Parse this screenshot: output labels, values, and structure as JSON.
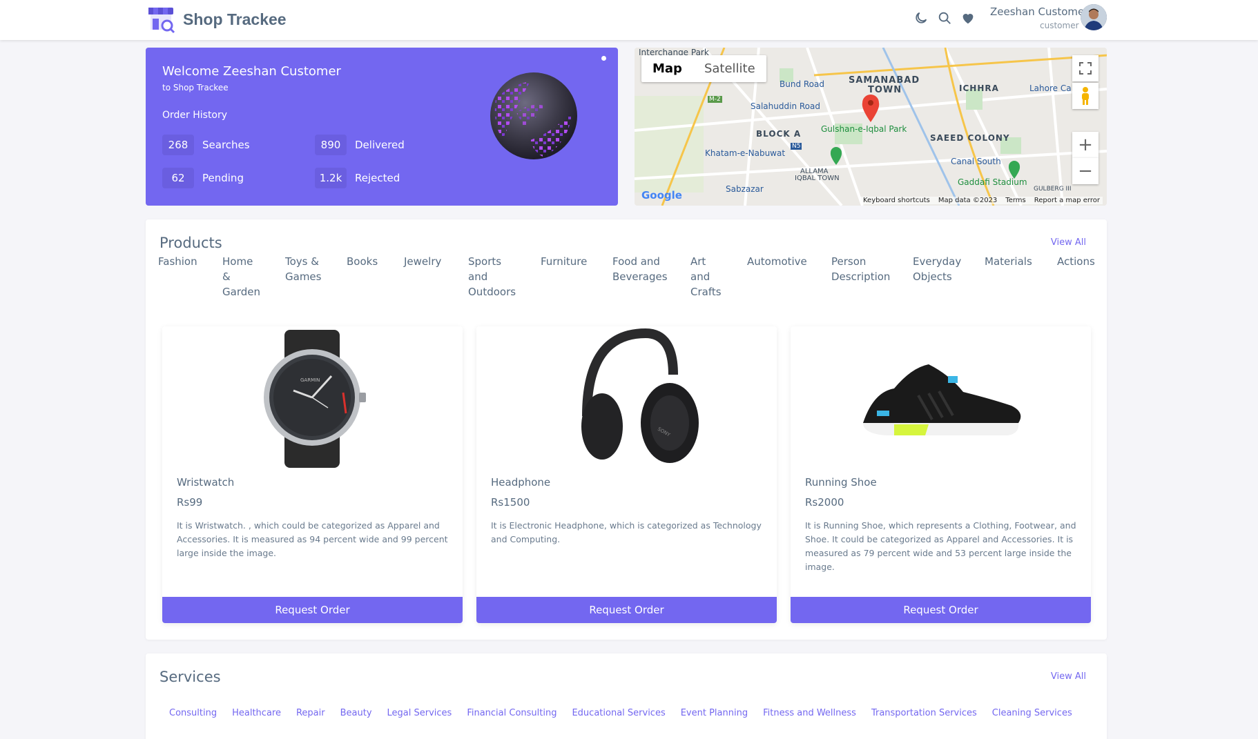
{
  "header": {
    "brand": "Shop Trackee",
    "icons": [
      "moon-icon",
      "search-icon",
      "heart-icon"
    ],
    "user_name": "Zeeshan Customer",
    "user_role": "customer"
  },
  "welcome": {
    "title": "Welcome Zeeshan Customer",
    "subtitle": "to Shop Trackee",
    "order_history": "Order History",
    "stats": [
      {
        "value": "268",
        "label": "Searches"
      },
      {
        "value": "890",
        "label": "Delivered"
      },
      {
        "value": "62",
        "label": "Pending"
      },
      {
        "value": "1.2k",
        "label": "Rejected"
      }
    ]
  },
  "map": {
    "tab_map": "Map",
    "tab_satellite": "Satellite",
    "labels": {
      "interchange": "Interchange Park",
      "samanabad": "SAMANABAD",
      "town": "TOWN",
      "ichhra": "ICHHRA",
      "bund_road": "Bund Road",
      "salahuddin": "Salahuddin Road",
      "block_a": "BLOCK A",
      "gulshan": "Gulshan-e-Iqbal Park",
      "saeed_colony": "SAEED COLONY",
      "khatam": "Khatam-e-Nabuwat",
      "allama": "ALLAMA",
      "iqbal_town": "IQBAL TOWN",
      "canal_south": "Canal South",
      "gaddafi": "Gaddafi Stadium",
      "sabzazar": "Sabzazar",
      "lahore_canal": "Lahore Ca",
      "gulberg": "GULBERG III",
      "m2": "M-2",
      "n5": "N5",
      "google": "Google"
    },
    "footer": [
      "Keyboard shortcuts",
      "Map data ©2023",
      "Terms",
      "Report a map error"
    ]
  },
  "products": {
    "title": "Products",
    "view_all": "View All",
    "categories": [
      "Fashion",
      "Home & Garden",
      "Toys & Games",
      "Books",
      "Jewelry",
      "Sports and Outdoors",
      "Furniture",
      "Food and Beverages",
      "Art and Crafts",
      "Automotive",
      "Person Description",
      "Everyday Objects",
      "Materials",
      "Actions"
    ],
    "items": [
      {
        "name": "Wristwatch",
        "price": "Rs99",
        "description": "It is Wristwatch. , which could be categorized as Apparel and Accessories. It is measured as 94 percent wide and 99 percent large inside the image.",
        "button": "Request Order",
        "watch_brand": "GARMIN"
      },
      {
        "name": "Headphone",
        "price": "Rs1500",
        "description": "It is Electronic Headphone, which is categorized as Technology and Computing.",
        "button": "Request Order",
        "headphone_brand": "SONY"
      },
      {
        "name": "Running Shoe",
        "price": "Rs2000",
        "description": "It is Running Shoe, which represents a Clothing, Footwear, and Shoe. It could be categorized as Apparel and Accessories. It is measured as 79 percent wide and 53 percent large inside the image.",
        "button": "Request Order"
      }
    ]
  },
  "services": {
    "title": "Services",
    "view_all": "View All",
    "items": [
      "Consulting",
      "Healthcare",
      "Repair",
      "Beauty",
      "Legal Services",
      "Financial Consulting",
      "Educational Services",
      "Event Planning",
      "Fitness and Wellness",
      "Transportation Services",
      "Cleaning Services"
    ]
  },
  "colors": {
    "primary": "#7367f0",
    "text": "#566a7f",
    "background": "#f5f5f9"
  }
}
